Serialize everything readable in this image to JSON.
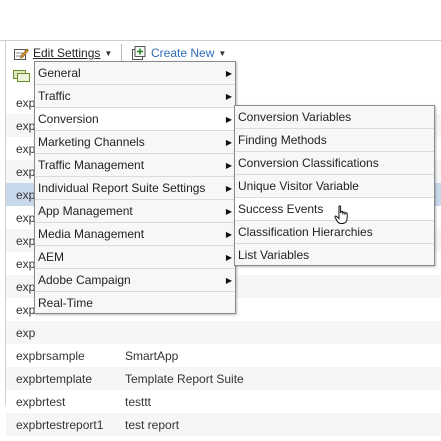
{
  "toolbar": {
    "edit_settings_label": "Edit Settings",
    "edit_settings_icon": "edit-settings-icon",
    "create_new_label": "Create New",
    "create_new_icon": "create-new-icon",
    "link_color": "#2d6cb5"
  },
  "table": {
    "rows": [
      {
        "id": "exp",
        "name": ""
      },
      {
        "id": "exp",
        "name": ""
      },
      {
        "id": "exp",
        "name": ""
      },
      {
        "id": "exp",
        "name": ""
      },
      {
        "id": "exp",
        "name": ""
      },
      {
        "id": "exp",
        "name": ""
      },
      {
        "id": "exp",
        "name": ""
      },
      {
        "id": "exp",
        "name": ""
      },
      {
        "id": "exp",
        "name": ""
      },
      {
        "id": "exp",
        "name": ""
      },
      {
        "id": "exp",
        "name": ""
      },
      {
        "id": "expbrsample",
        "name": "SmartApp"
      },
      {
        "id": "expbrtemplate",
        "name": "Template Report Suite"
      },
      {
        "id": "expbrtest",
        "name": "testtt"
      },
      {
        "id": "expbrtestreport1",
        "name": "test report"
      }
    ],
    "selected_row_color": "#c9d9ec"
  },
  "menu": {
    "items": [
      {
        "label": "General",
        "has_submenu": true
      },
      {
        "label": "Traffic",
        "has_submenu": true
      },
      {
        "label": "Conversion",
        "has_submenu": true
      },
      {
        "label": "Marketing Channels",
        "has_submenu": true
      },
      {
        "label": "Traffic Management",
        "has_submenu": true
      },
      {
        "label": "Individual Report Suite Settings",
        "has_submenu": true
      },
      {
        "label": "App Management",
        "has_submenu": true
      },
      {
        "label": "Media Management",
        "has_submenu": true
      },
      {
        "label": "AEM",
        "has_submenu": true
      },
      {
        "label": "Adobe Campaign",
        "has_submenu": true
      },
      {
        "label": "Real-Time",
        "has_submenu": false
      }
    ],
    "active_item": "Conversion"
  },
  "submenu": {
    "items": [
      {
        "label": "Conversion Variables"
      },
      {
        "label": "Finding Methods"
      },
      {
        "label": "Conversion Classifications"
      },
      {
        "label": "Unique Visitor Variable"
      },
      {
        "label": "Success Events"
      },
      {
        "label": "Classification Hierarchies"
      },
      {
        "label": "List Variables"
      }
    ],
    "hovered_item": "Success Events"
  },
  "cursor": {
    "icon": "hand-pointer-icon"
  }
}
